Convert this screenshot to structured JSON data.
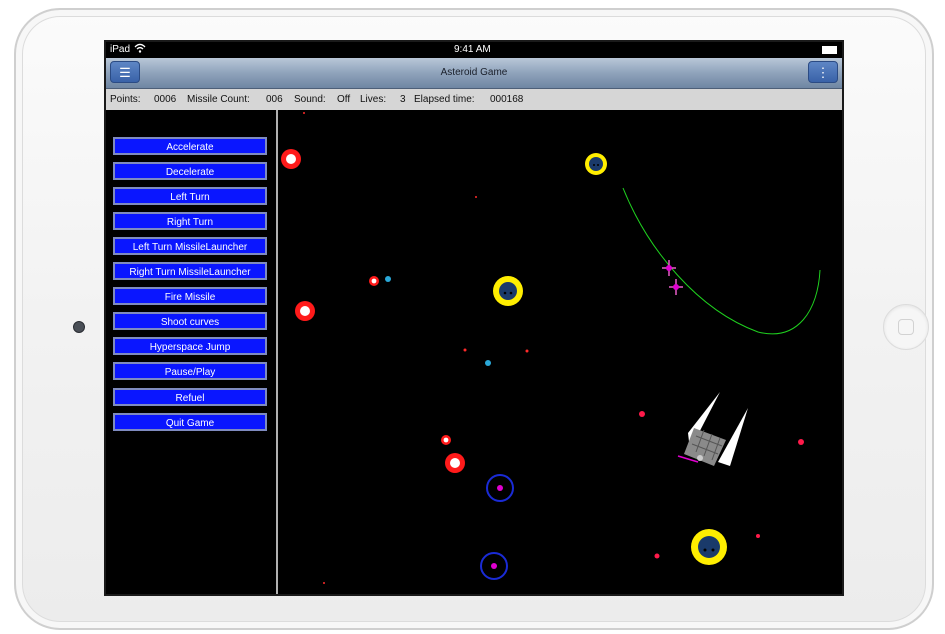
{
  "status_bar": {
    "device": "iPad",
    "time": "9:41 AM"
  },
  "nav": {
    "title": "Asteroid Game",
    "menu_icon": "hamburger-icon",
    "more_icon": "vertical-dots-icon"
  },
  "stats": {
    "points_label": "Points:",
    "points_value": "0006",
    "missile_label": "Missile Count:",
    "missile_value": "006",
    "sound_label": "Sound:",
    "sound_value": "Off",
    "lives_label": "Lives:",
    "lives_value": "3",
    "elapsed_label": "Elapsed time:",
    "elapsed_value": "000168"
  },
  "controls": [
    "Accelerate",
    "Decelerate",
    "Left Turn",
    "Right Turn",
    "Left Turn MissileLauncher",
    "Right Turn MissileLauncher",
    "Fire Missile",
    "Shoot curves",
    "Hyperspace Jump",
    "Pause/Play",
    "Refuel",
    "Quit Game"
  ],
  "colors": {
    "button_fill": "#0a16ff",
    "asteroid_ring": "#ff1a1a",
    "enemy_ring": "#ffee00",
    "enemy_core": "#1a3a6a",
    "portal_ring": "#1a2bd6",
    "portal_core": "#e000d0",
    "trajectory": "#1fd11f",
    "satellite": "#e85cc8"
  }
}
